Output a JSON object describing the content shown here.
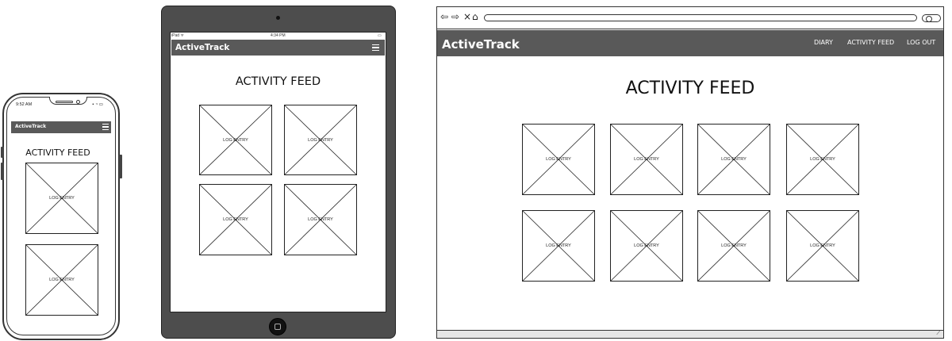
{
  "app": {
    "brand": "ActiveTrack",
    "feed_title": "ACTIVITY FEED",
    "card_label": "LOG ENTRY"
  },
  "phone": {
    "status_time": "9:52 AM",
    "status_icons": "▪ ◔ ▭"
  },
  "tablet": {
    "status_left": "iPad ᯤ",
    "status_time": "4:34 PM",
    "status_right": "▭"
  },
  "browser": {
    "nav_links": [
      "DIARY",
      "ACTIVITY FEED",
      "LOG OUT"
    ],
    "controls": {
      "back": "⇦",
      "forward": "⇨",
      "close": "×",
      "home": "⌂"
    }
  },
  "icons": {
    "menu": "hamburger-icon",
    "placeholder": "image-placeholder-icon",
    "home": "home-button-icon"
  },
  "colors": {
    "navbar": "#595959",
    "tablet_bezel": "#4d4d4d",
    "text": "#111111"
  }
}
